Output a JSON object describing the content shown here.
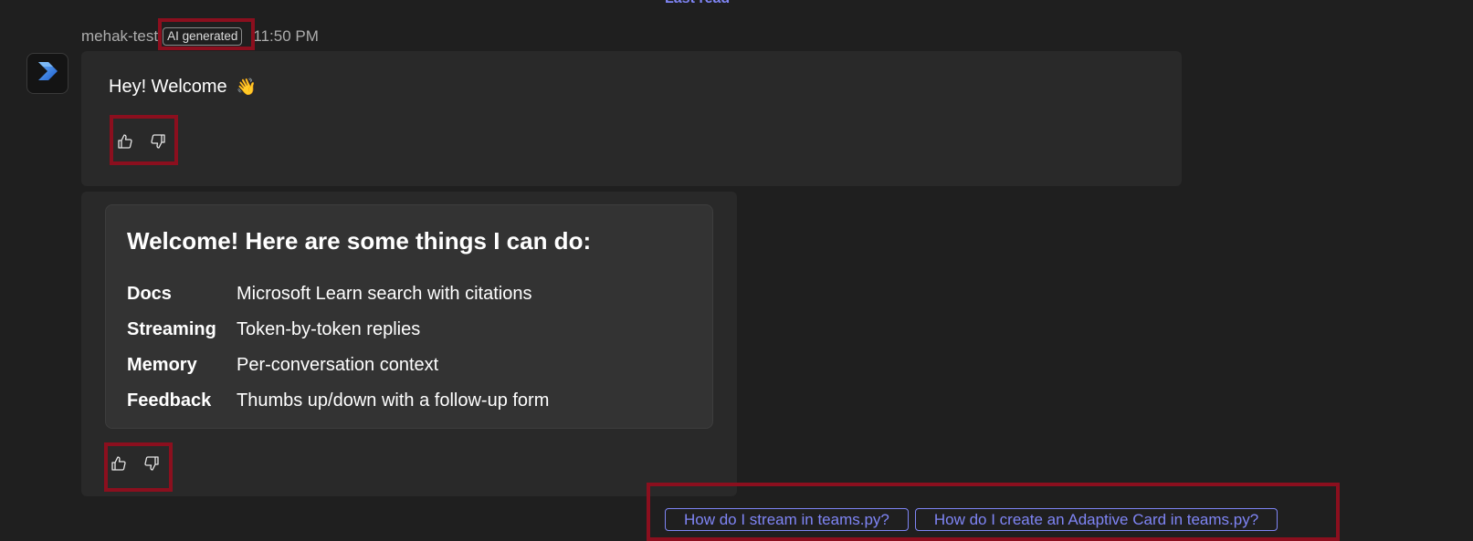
{
  "last_read_label": "Last read",
  "message": {
    "sender": "mehak-test",
    "ai_badge": "AI generated",
    "timestamp": "11:50 PM",
    "greeting": "Hey! Welcome",
    "greeting_emoji": "👋",
    "avatar_icon": "copilot-chevron-icon"
  },
  "card": {
    "title": "Welcome! Here are some things I can do:",
    "rows": [
      {
        "key": "Docs",
        "value": "Microsoft Learn search with citations"
      },
      {
        "key": "Streaming",
        "value": "Token-by-token replies"
      },
      {
        "key": "Memory",
        "value": "Per-conversation context"
      },
      {
        "key": "Feedback",
        "value": "Thumbs up/down with a follow-up form"
      }
    ]
  },
  "feedback": {
    "thumbs_up_icon": "thumbs-up-icon",
    "thumbs_down_icon": "thumbs-down-icon"
  },
  "suggestions": [
    "How do I stream in teams.py?",
    "How do I create an Adaptive Card in teams.py?"
  ],
  "colors": {
    "background": "#1f1f1f",
    "bubble": "#292929",
    "card": "#333333",
    "accent": "#7f85f5",
    "highlight": "#8b0f1e"
  }
}
